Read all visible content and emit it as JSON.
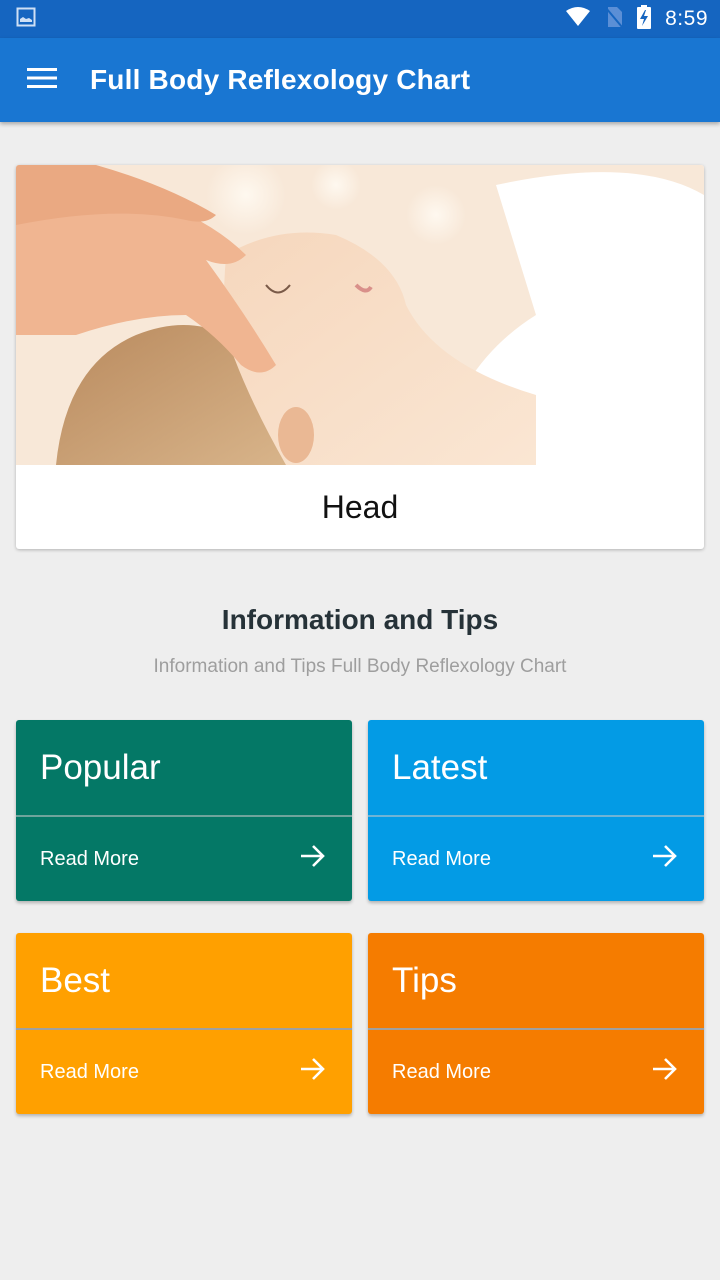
{
  "status_bar": {
    "time": "8:59",
    "icons": [
      "image-notification-icon",
      "wifi-icon",
      "no-sim-icon",
      "battery-charging-icon"
    ]
  },
  "app_bar": {
    "menu_icon": "hamburger-menu-icon",
    "title": "Full Body Reflexology Chart",
    "color": "#1976d2"
  },
  "hero": {
    "image_description": "Woman receiving head massage",
    "caption": "Head"
  },
  "section": {
    "title": "Information and Tips",
    "subtitle": "Information and Tips Full Body Reflexology Chart"
  },
  "tiles": [
    {
      "title": "Popular",
      "action": "Read More",
      "icon": "arrow-right-icon",
      "color": "#047866"
    },
    {
      "title": "Latest",
      "action": "Read More",
      "icon": "arrow-right-icon",
      "color": "#039be5"
    },
    {
      "title": "Best",
      "action": "Read More",
      "icon": "arrow-right-icon",
      "color": "#ffa000"
    },
    {
      "title": "Tips",
      "action": "Read More",
      "icon": "arrow-right-icon",
      "color": "#f57c00"
    }
  ]
}
